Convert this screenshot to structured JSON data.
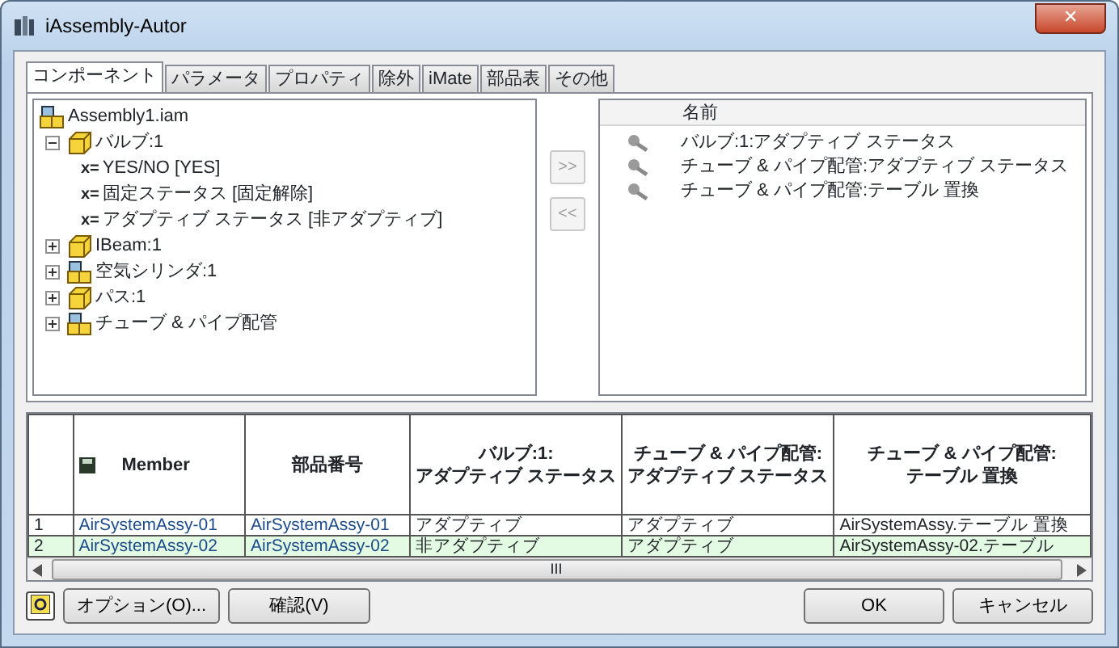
{
  "window": {
    "title": "iAssembly-Autor",
    "close": "✕"
  },
  "tabs": [
    {
      "label": "コンポーネント",
      "selected": true
    },
    {
      "label": "パラメータ",
      "selected": false
    },
    {
      "label": "プロパティ",
      "selected": false
    },
    {
      "label": "除外",
      "selected": false
    },
    {
      "label": "iMate",
      "selected": false
    },
    {
      "label": "部品表",
      "selected": false
    },
    {
      "label": "その他",
      "selected": false
    }
  ],
  "tree": [
    {
      "label": "Assembly1.iam",
      "kind": "assembly",
      "children": [
        {
          "label": "バルブ:1",
          "kind": "part",
          "expanded": true,
          "children": [
            {
              "label": "YES/NO [YES]",
              "kind": "parameter",
              "prefix": "x="
            },
            {
              "label": "固定ステータス [固定解除]",
              "kind": "parameter",
              "prefix": "x="
            },
            {
              "label": "アダプティブ ステータス [非アダプティブ]",
              "kind": "parameter",
              "prefix": "x="
            }
          ]
        },
        {
          "label": "IBeam:1",
          "kind": "part",
          "expanded": false
        },
        {
          "label": "空気シリンダ:1",
          "kind": "assembly",
          "expanded": false
        },
        {
          "label": "パス:1",
          "kind": "part",
          "expanded": false
        },
        {
          "label": "チューブ & パイプ配管",
          "kind": "assembly",
          "expanded": false
        }
      ]
    }
  ],
  "move_buttons": [
    {
      "label": ">>",
      "disabled": true
    },
    {
      "label": "<<",
      "disabled": true
    }
  ],
  "selected_list": {
    "column": "名前",
    "items": [
      "バルブ:1:アダプティブ ステータス",
      "チューブ & パイプ配管:アダプティブ ステータス",
      "チューブ & パイプ配管:テーブル 置換"
    ]
  },
  "table": {
    "columns": [
      "Member",
      "部品番号",
      "バルブ:1:\nアダプティブ ステータス",
      "チューブ & パイプ配管:\nアダプティブ ステータス",
      "チューブ & パイプ配管:\nテーブル 置換"
    ],
    "rows": [
      {
        "index": "1",
        "selected": false,
        "cells": [
          "AirSystemAssy-01",
          "AirSystemAssy-01",
          "アダプティブ",
          "アダプティブ",
          "AirSystemAssy.テーブル 置換"
        ]
      },
      {
        "index": "2",
        "selected": true,
        "cells": [
          "AirSystemAssy-02",
          "AirSystemAssy-02",
          "非アダプティブ",
          "アダプティブ",
          "AirSystemAssy-02.テーブル"
        ]
      }
    ],
    "scrollbar": "III"
  },
  "buttons": [
    {
      "label": "オプション(O)...",
      "kind": "left"
    },
    {
      "label": "確認(V)",
      "kind": "left"
    },
    {
      "label": "OK",
      "kind": "right"
    },
    {
      "label": "キャンセル",
      "kind": "right"
    }
  ]
}
